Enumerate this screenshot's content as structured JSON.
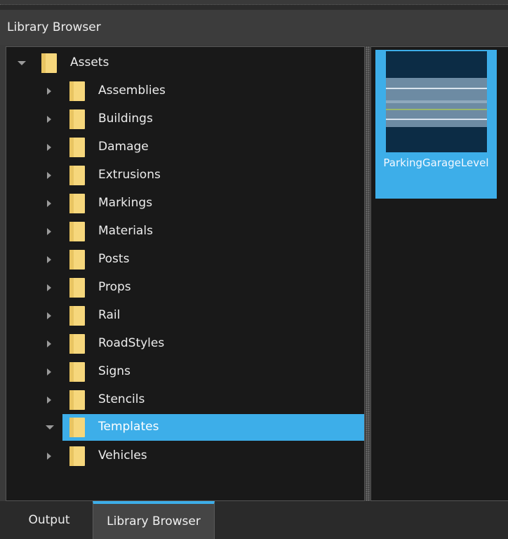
{
  "window": {
    "title": "Library Browser"
  },
  "tree": {
    "root": {
      "label": "Assets",
      "expanded": true
    },
    "items": [
      {
        "label": "Assemblies",
        "expanded": false,
        "selected": false
      },
      {
        "label": "Buildings",
        "expanded": false,
        "selected": false
      },
      {
        "label": "Damage",
        "expanded": false,
        "selected": false
      },
      {
        "label": "Extrusions",
        "expanded": false,
        "selected": false
      },
      {
        "label": "Markings",
        "expanded": false,
        "selected": false
      },
      {
        "label": "Materials",
        "expanded": false,
        "selected": false
      },
      {
        "label": "Posts",
        "expanded": false,
        "selected": false
      },
      {
        "label": "Props",
        "expanded": false,
        "selected": false
      },
      {
        "label": "Rail",
        "expanded": false,
        "selected": false
      },
      {
        "label": "RoadStyles",
        "expanded": false,
        "selected": false
      },
      {
        "label": "Signs",
        "expanded": false,
        "selected": false
      },
      {
        "label": "Stencils",
        "expanded": false,
        "selected": false
      },
      {
        "label": "Templates",
        "expanded": true,
        "selected": true
      },
      {
        "label": "Vehicles",
        "expanded": false,
        "selected": false
      }
    ]
  },
  "grid": {
    "items": [
      {
        "label": "ParkingGarageLevel",
        "selected": true
      }
    ]
  },
  "tabs": [
    {
      "label": "Output",
      "active": false
    },
    {
      "label": "Library Browser",
      "active": true
    }
  ],
  "colors": {
    "accent": "#3daee9",
    "folder": "#f6d77c",
    "background": "#191919"
  }
}
